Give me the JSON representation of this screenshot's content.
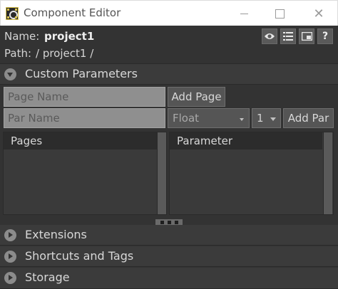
{
  "window": {
    "title": "Component Editor",
    "close_glyph": "✕"
  },
  "header": {
    "name_label": "Name:",
    "name_value": "project1",
    "path_label": "Path:",
    "path_value": "/ project1 /",
    "help_label": "?"
  },
  "sections": {
    "custom_parameters": "Custom Parameters",
    "extensions": "Extensions",
    "shortcuts_tags": "Shortcuts and Tags",
    "storage": "Storage"
  },
  "custom_parameters": {
    "page_name_placeholder": "Page Name",
    "add_page_label": "Add Page",
    "par_name_placeholder": "Par Name",
    "type_value": "Float",
    "size_value": "1",
    "add_par_label": "Add Par",
    "pages_header": "Pages",
    "parameter_header": "Parameter"
  },
  "icons": {
    "app": "component-editor-app-icon",
    "viewer": "eye-icon",
    "list": "list-icon",
    "view": "window-icon",
    "help": "help-icon"
  },
  "colors": {
    "panel_bg": "#333333",
    "field_bg": "#8f8f8f",
    "button_bg": "#555555"
  }
}
